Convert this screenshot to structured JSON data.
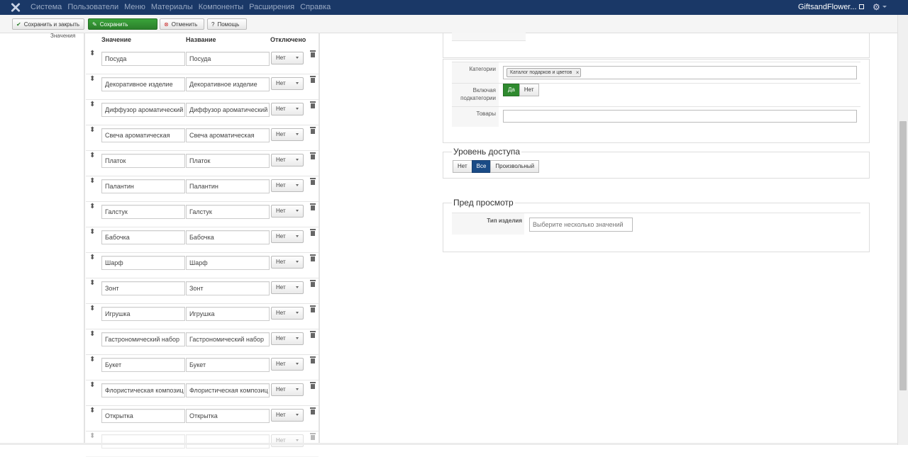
{
  "topbar": {
    "menu": [
      "Система",
      "Пользователи",
      "Меню",
      "Материалы",
      "Компоненты",
      "Расширения",
      "Справка"
    ],
    "site_name": "GiftsandFlower...",
    "gear_icon": "gear-icon"
  },
  "toolbar": {
    "save_close": "Сохранить и закрыть",
    "save": "Сохранить",
    "cancel": "Отменить",
    "help": "Помощь"
  },
  "values_panel": {
    "sidebar_label": "Значения",
    "headers": {
      "value": "Значение",
      "name": "Название",
      "disabled": "Отключено"
    },
    "rows": [
      {
        "value": "Посуда",
        "name": "Посуда",
        "disabled": "Нет"
      },
      {
        "value": "Декоративное изделие",
        "name": "Декоративное изделие",
        "disabled": "Нет"
      },
      {
        "value": "Диффузор ароматический",
        "name": "Диффузор ароматический",
        "disabled": "Нет"
      },
      {
        "value": "Свеча ароматическая",
        "name": "Свеча ароматическая",
        "disabled": "Нет"
      },
      {
        "value": "Платок",
        "name": "Платок",
        "disabled": "Нет"
      },
      {
        "value": "Палантин",
        "name": "Палантин",
        "disabled": "Нет"
      },
      {
        "value": "Галстук",
        "name": "Галстук",
        "disabled": "Нет"
      },
      {
        "value": "Бабочка",
        "name": "Бабочка",
        "disabled": "Нет"
      },
      {
        "value": "Шарф",
        "name": "Шарф",
        "disabled": "Нет"
      },
      {
        "value": "Зонт",
        "name": "Зонт",
        "disabled": "Нет"
      },
      {
        "value": "Игрушка",
        "name": "Игрушка",
        "disabled": "Нет"
      },
      {
        "value": "Гастрономический набор",
        "name": "Гастрономический набор",
        "disabled": "Нет"
      },
      {
        "value": "Букет",
        "name": "Букет",
        "disabled": "Нет"
      },
      {
        "value": "Флористическая композиц",
        "name": "Флористическая композиц",
        "disabled": "Нет"
      },
      {
        "value": "Открытка",
        "name": "Открытка",
        "disabled": "Нет"
      },
      {
        "value": "",
        "name": "",
        "disabled": "Нет"
      }
    ]
  },
  "assignment": {
    "categories_label": "Категории",
    "categories_tag": "Каталог подарков и цветов",
    "include_sub_label": "Включая подкатегории",
    "include_yes": "Да",
    "include_no": "Нет",
    "products_label": "Товары",
    "products_value": ""
  },
  "access": {
    "legend": "Уровень доступа",
    "options": [
      "Нет",
      "Все",
      "Произвольный"
    ],
    "selected": "Все"
  },
  "preview": {
    "legend": "Пред просмотр",
    "type_label": "Тип изделия",
    "type_placeholder": "Выберите несколько значений"
  },
  "colors": {
    "topbar": "#1a3867",
    "save_green": "#2f8a2f",
    "active_blue": "#1a4b86"
  }
}
